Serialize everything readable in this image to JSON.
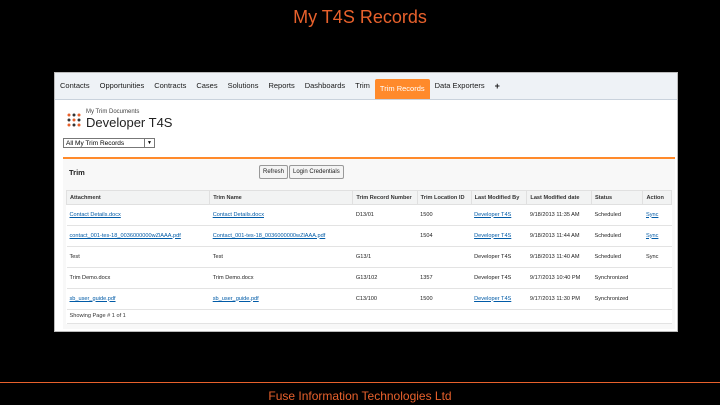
{
  "slide": {
    "title": "My T4S Records",
    "footer": "Fuse Information Technologies Ltd"
  },
  "nav": {
    "tabs": [
      "Contacts",
      "Opportunities",
      "Contracts",
      "Cases",
      "Solutions",
      "Reports",
      "Dashboards",
      "Trim",
      "Trim Records",
      "Data Exporters",
      "+"
    ],
    "active": "Trim Records"
  },
  "header": {
    "subtitle": "My Trim Documents",
    "title": "Developer T4S",
    "view_select": "All My Trim Records"
  },
  "panel": {
    "title": "Trim",
    "refresh_button": "Refresh",
    "login_button": "Login Credentials"
  },
  "table": {
    "columns": [
      "Attachment",
      "Trim Name",
      "Trim Record Number",
      "Trim Location ID",
      "Last Modified By",
      "Last Modified date",
      "Status",
      "Action"
    ],
    "rows": [
      [
        "Contact Details.docx",
        "Contact Details.docx",
        "D13/01",
        "1500",
        "Developer T4S",
        "9/18/2013 11:35 AM",
        "Scheduled",
        "Sync"
      ],
      [
        "contact_001-tes-18_0036000000wZlAAA.pdf",
        "Contact_001-tes-18_0036000000wZlAAA.pdf",
        "",
        "1504",
        "Developer T4S",
        "9/18/2013 11:44 AM",
        "Scheduled",
        "Sync"
      ],
      [
        "Test",
        "Test",
        "G13/1",
        "",
        "Developer T4S",
        "9/18/2013 11:40 AM",
        "Scheduled",
        "Sync"
      ],
      [
        "Trim Demo.docx",
        "Trim Demo.docx",
        "G13/102",
        "1357",
        "Developer T4S",
        "9/17/2013 10:40 PM",
        "Synchronized",
        ""
      ],
      [
        "sb_user_guide.pdf",
        "sb_user_guide.pdf",
        "C13/100",
        "1500",
        "Developer T4S",
        "9/17/2013 11:30 PM",
        "Synchronized",
        ""
      ]
    ],
    "footer": "Showing Page # 1 of 1"
  },
  "colors": {
    "accent": "#e8612c",
    "tab_active": "#ff8a2b",
    "link": "#015ba7"
  },
  "icons": {
    "logo": "dots-logo-icon",
    "dropdown": "chevron-down-icon"
  }
}
